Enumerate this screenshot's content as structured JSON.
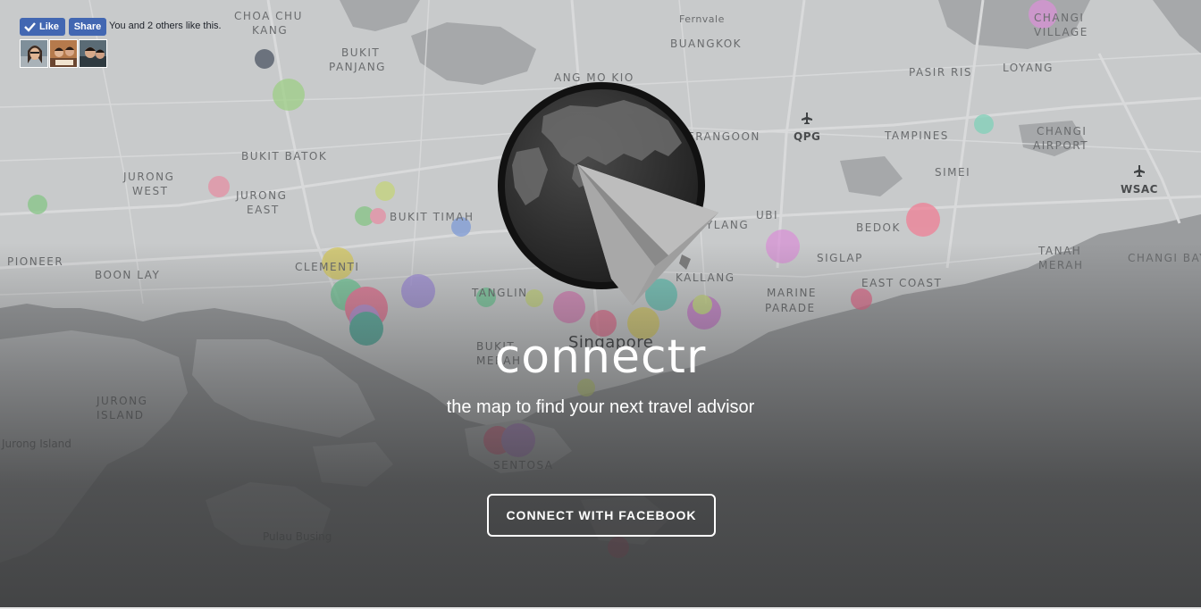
{
  "facebook": {
    "like_label": "Like",
    "share_label": "Share",
    "social_text": "You and 2 others like this.",
    "brand_color": "#4267b2"
  },
  "map": {
    "places": [
      "CHOA CHU",
      "KANG",
      "BUKIT",
      "PANJANG",
      "Fernvale",
      "BUANGKOK",
      "CHANGI",
      "VILLAGE",
      "ANG MO KIO",
      "PASIR RIS",
      "LOYANG",
      "JURONG",
      "WEST",
      "BUKIT BATOK",
      "JURONG",
      "EAST",
      "BUKIT TIMAH",
      "SERANGOON",
      "QPG",
      "TAMPINES",
      "CHANGI",
      "AIRPORT",
      "SIMEI",
      "WSAC",
      "PIONEER",
      "BOON LAY",
      "CLEMENTI",
      "UBI",
      "BEDOK",
      "GEYLANG",
      "TANAH",
      "MERAH",
      "CHANGI BAY",
      "SIGLAP",
      "TANGLIN",
      "KALLANG",
      "MARINE",
      "PARADE",
      "EAST COAST",
      "Singapore",
      "BUKIT",
      "MERAH",
      "JURONG",
      "ISLAND",
      "Jurong Island",
      "SENTOSA",
      "Pulau Busing"
    ],
    "land_color": "#c9cbcc",
    "water_color": "#9b9d9f"
  },
  "hero": {
    "brand": "connectr",
    "tagline": "the map to find your next travel advisor",
    "cta_label": "CONNECT WITH FACEBOOK"
  }
}
